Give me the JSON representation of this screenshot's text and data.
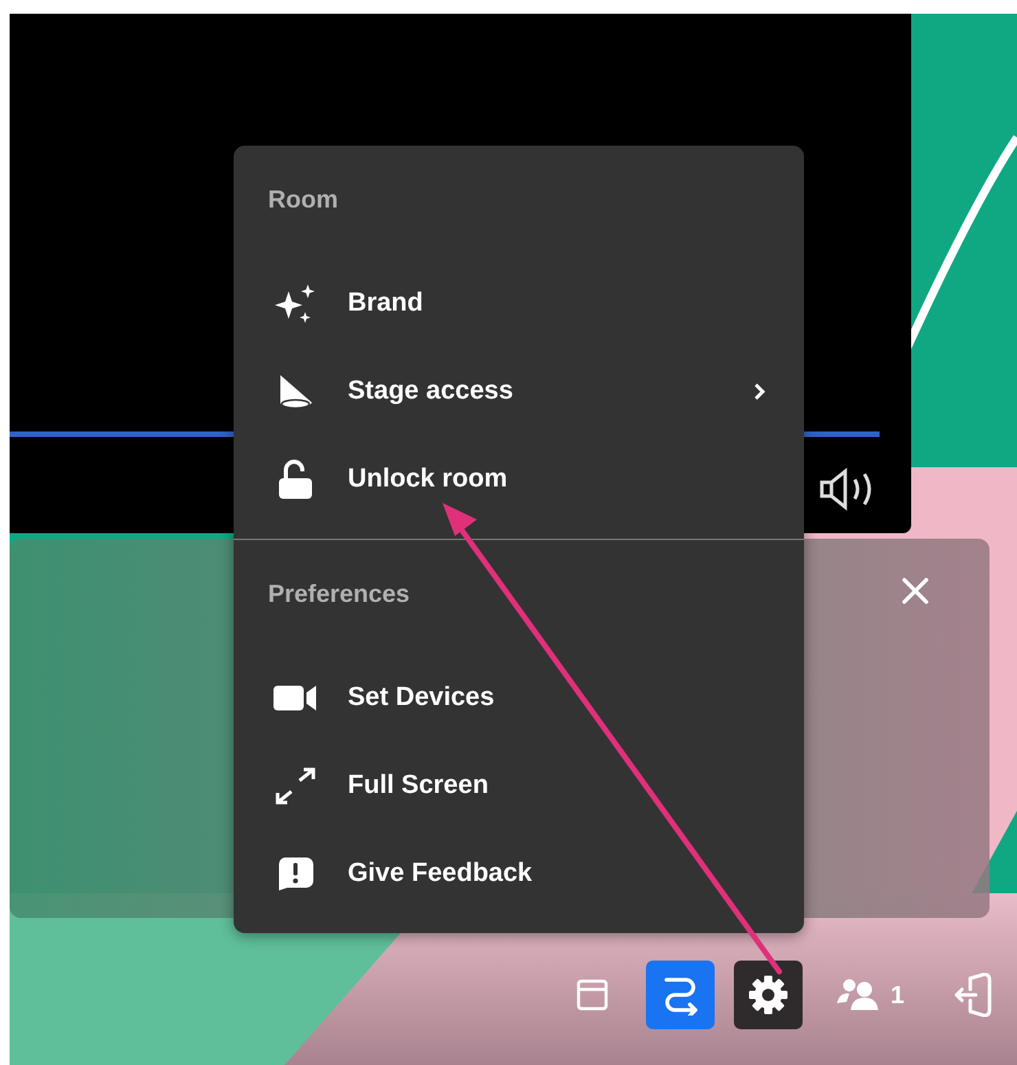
{
  "menu": {
    "sections": [
      {
        "title": "Room",
        "items": [
          {
            "label": "Brand",
            "kind": "sparkles",
            "submenu": false
          },
          {
            "label": "Stage access",
            "kind": "cone",
            "submenu": true
          },
          {
            "label": "Unlock room",
            "kind": "unlock",
            "submenu": false
          }
        ]
      },
      {
        "title": "Preferences",
        "items": [
          {
            "label": "Set Devices",
            "kind": "camera",
            "submenu": false
          },
          {
            "label": "Full Screen",
            "kind": "expand",
            "submenu": false
          },
          {
            "label": "Give Feedback",
            "kind": "feedback",
            "submenu": false
          }
        ]
      }
    ]
  },
  "toolbar": {
    "buttons": [
      {
        "kind": "layout",
        "on": false,
        "selected": false
      },
      {
        "kind": "route",
        "on": true,
        "selected": false
      },
      {
        "kind": "settings",
        "on": false,
        "selected": true
      }
    ],
    "participants": "1"
  }
}
